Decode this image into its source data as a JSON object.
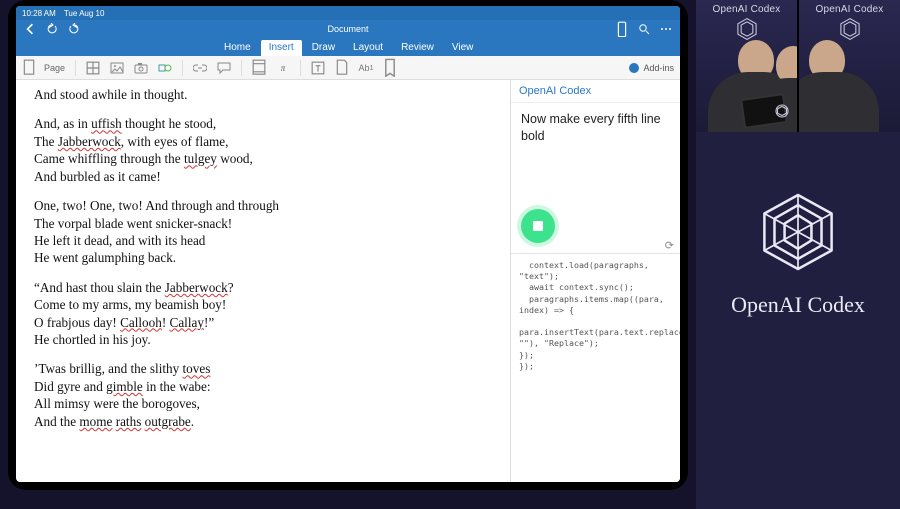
{
  "status": {
    "time": "10:28 AM",
    "date": "Tue Aug 10"
  },
  "titlebar": {
    "docname": "Document"
  },
  "tabs": {
    "home": "Home",
    "insert": "Insert",
    "draw": "Draw",
    "layout": "Layout",
    "review": "Review",
    "view": "View"
  },
  "ribbon": {
    "page": "Page",
    "addins": "Add-ins",
    "pi": "π",
    "ab": "Ab"
  },
  "doc": {
    "l1": "And stood awhile in thought.",
    "l2a": "And, as in ",
    "l2b": "uffish",
    "l2c": " thought he stood,",
    "l3a": "The ",
    "l3b": "Jabberwock",
    "l3c": ", with eyes of flame,",
    "l4a": "Came whiffling through the ",
    "l4b": "tulgey",
    "l4c": " wood,",
    "l5": "And burbled as it came!",
    "l6": "One, two! One, two! And through and through",
    "l7": "The vorpal blade went snicker-snack!",
    "l8": "He left it dead, and with its head",
    "l9": "He went galumphing back.",
    "l10a": "“And hast thou slain the ",
    "l10b": "Jabberwock",
    "l10c": "?",
    "l11": "Come to my arms, my beamish boy!",
    "l12a": "O frabjous day! ",
    "l12b": "Callooh",
    "l12c": "! ",
    "l12d": "Callay",
    "l12e": "!”",
    "l13": "He chortled in his joy.",
    "l14a": "’Twas brillig, and the slithy ",
    "l14b": "toves",
    "l15a": "Did gyre and ",
    "l15b": "gimble",
    "l15c": " in the wabe:",
    "l16": "All mimsy were the borogoves,",
    "l17a": "And the ",
    "l17b": "mome",
    "l17c": " ",
    "l17d": "raths",
    "l17e": " ",
    "l17f": "outgrabe",
    "l17g": "."
  },
  "taskpane": {
    "title": "OpenAI Codex",
    "prompt": "Now make every fifth line bold",
    "code": "  context.load(paragraphs,\n\"text\");\n  await context.sync();\n  paragraphs.items.map((para,\nindex) => {\n\npara.insertText(para.text.replace(\n\"\"), \"Replace\");\n});\n});"
  },
  "brand": {
    "label": "OpenAI Codex",
    "tileLabel": "OpenAI Codex"
  }
}
